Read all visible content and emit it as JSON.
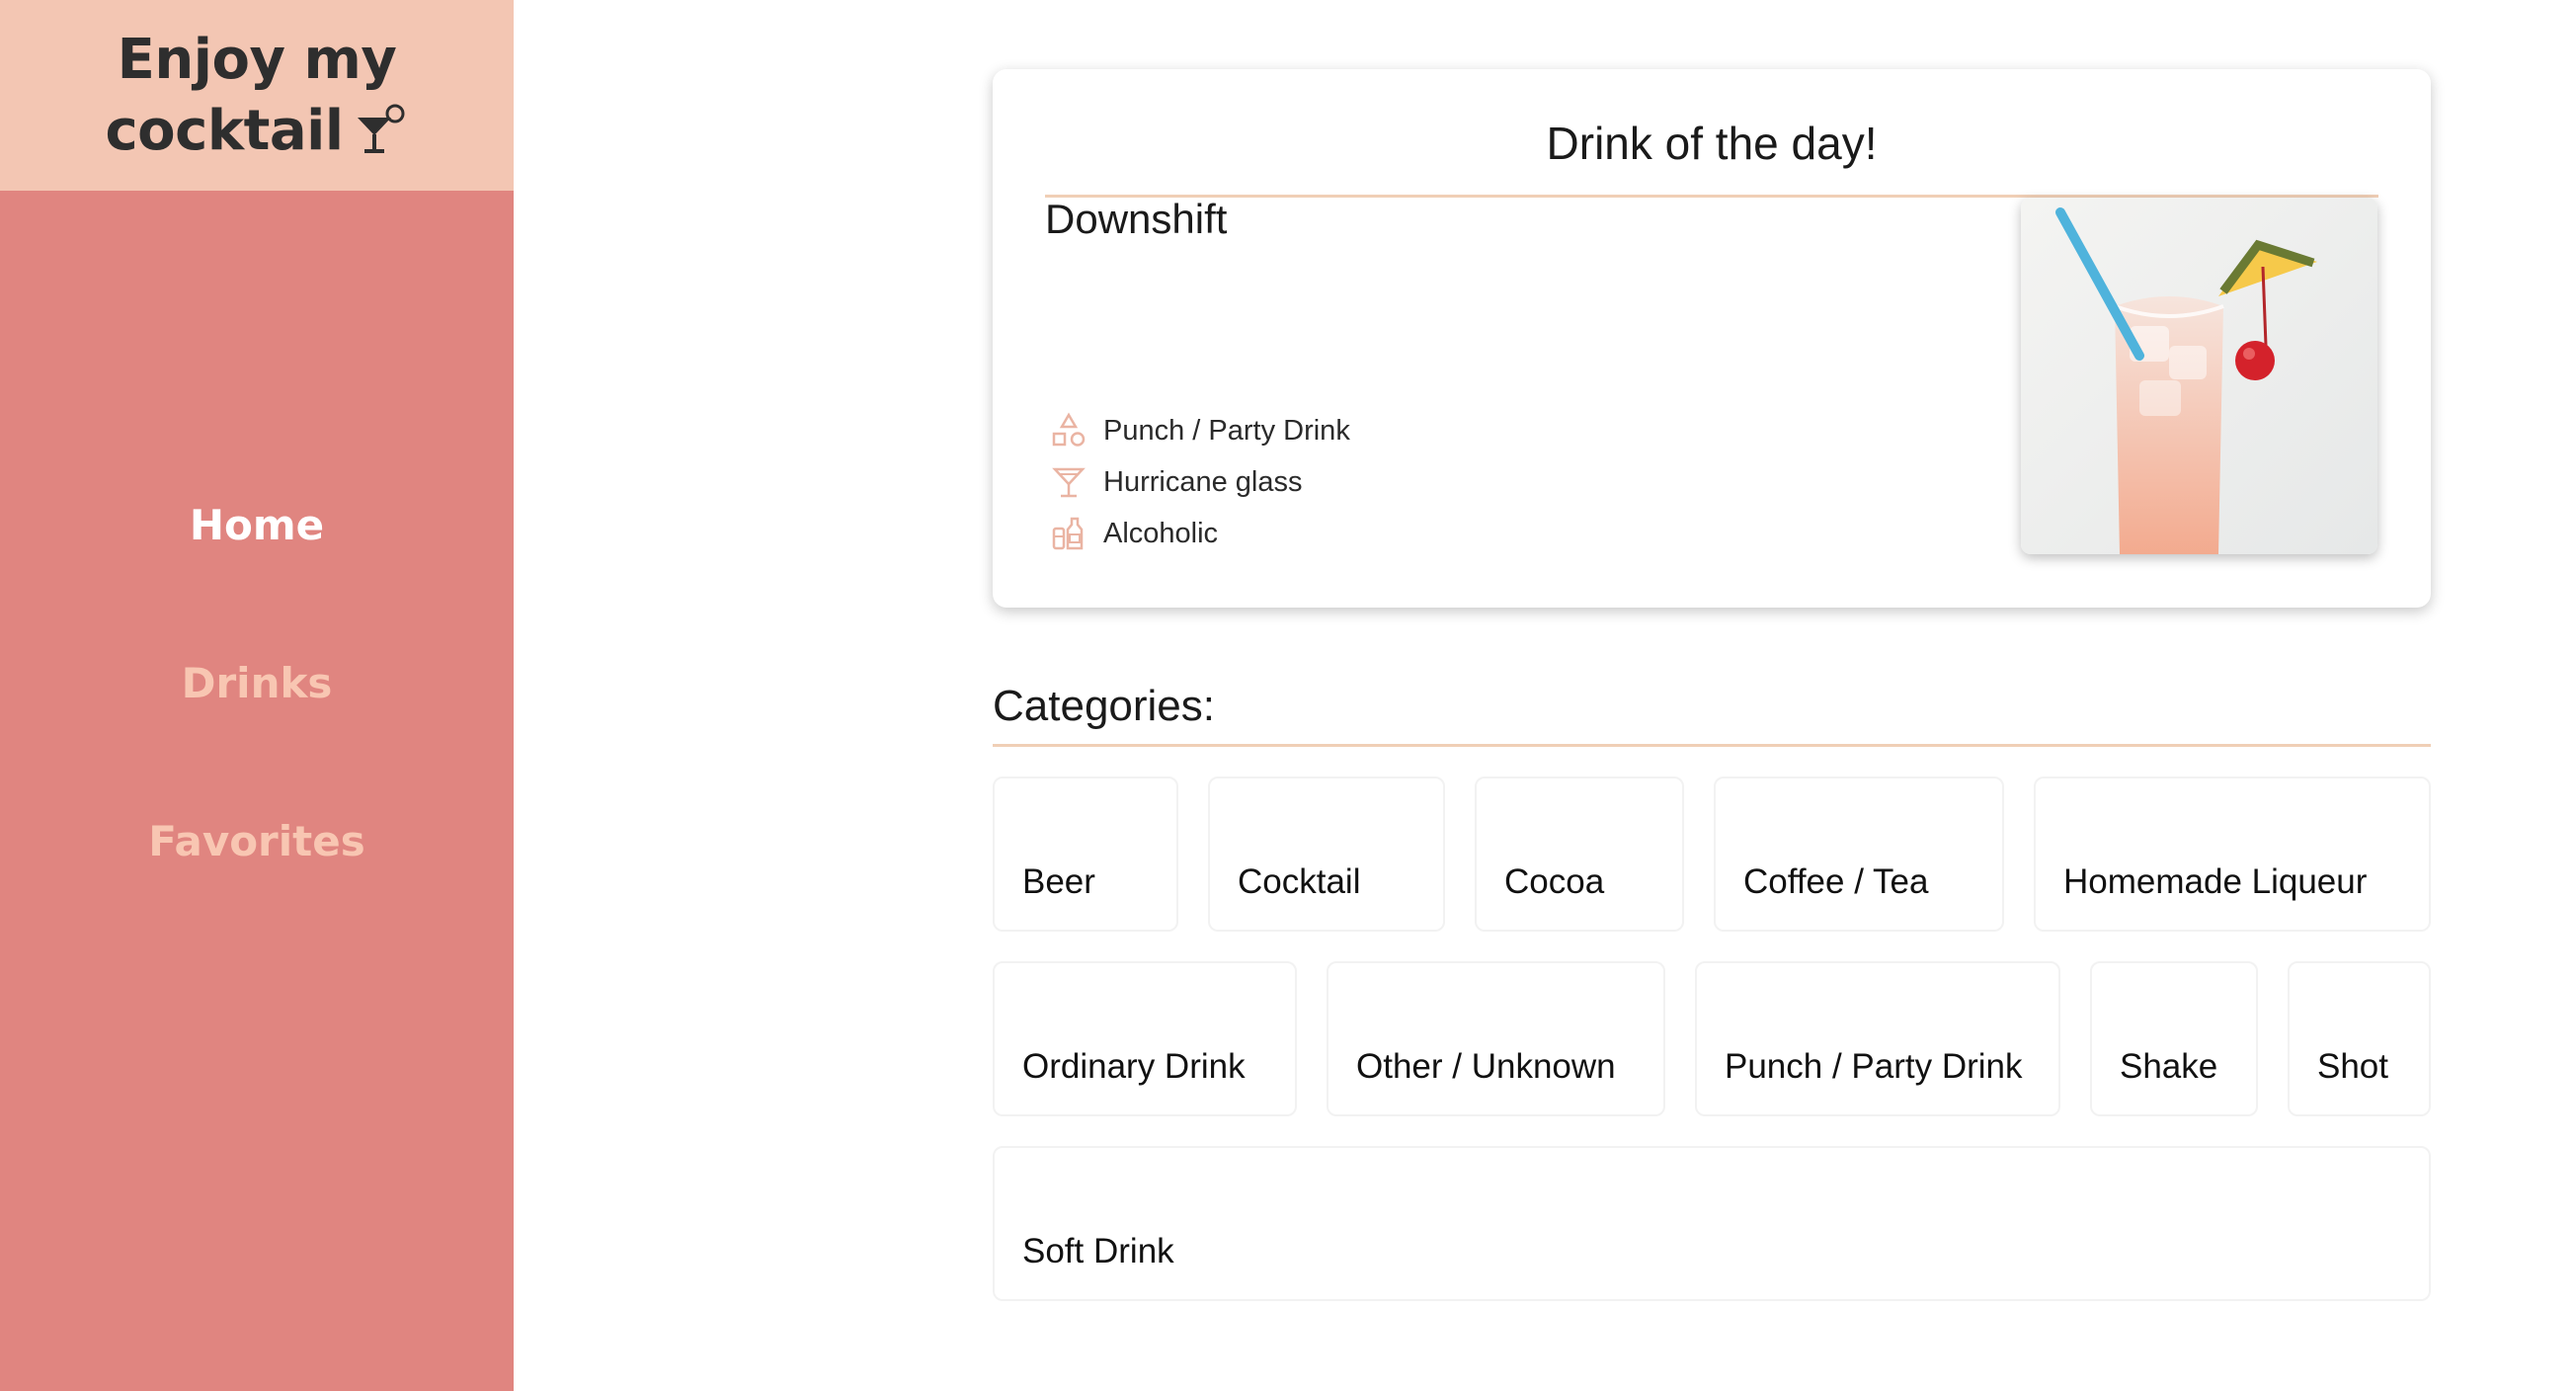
{
  "brand": {
    "line1": "Enjoy my",
    "line2": "cocktail",
    "icon": "cocktail-glass-icon"
  },
  "nav": [
    {
      "label": "Home",
      "active": true
    },
    {
      "label": "Drinks",
      "active": false
    },
    {
      "label": "Favorites",
      "active": false
    }
  ],
  "drink_of_day": {
    "title": "Drink of the day!",
    "name": "Downshift",
    "category": "Punch / Party Drink",
    "glass": "Hurricane glass",
    "alcoholic": "Alcoholic"
  },
  "categories": {
    "heading": "Categories:",
    "items": [
      "Beer",
      "Cocktail",
      "Cocoa",
      "Coffee / Tea",
      "Homemade Liqueur",
      "Ordinary Drink",
      "Other / Unknown",
      "Punch / Party Drink",
      "Shake",
      "Shot",
      "Soft Drink"
    ]
  },
  "colors": {
    "sidebar": "#e08580",
    "brand_bg": "#f3c6b3",
    "accent": "#f0cfb6",
    "nav_inactive": "#f8c6b2"
  }
}
